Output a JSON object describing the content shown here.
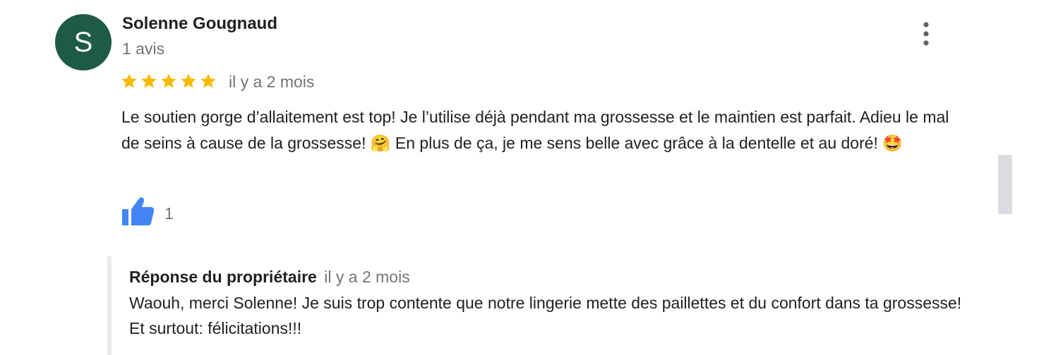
{
  "review": {
    "avatar_letter": "S",
    "avatar_color": "#1e5a47",
    "author_name": "Solenne Gougnaud",
    "author_review_count": "1 avis",
    "rating": 5,
    "rating_max": 5,
    "star_color": "#f6bb06",
    "date": "il y a 2 mois",
    "text": "Le soutien gorge d’allaitement est top! Je l’utilise déjà pendant ma grossesse et le maintien est parfait. Adieu le mal de seins à cause de la grossesse! 🤗 En plus de ça, je me sens belle avec grâce à la dentelle et au doré! 🤩",
    "like_count": "1",
    "like_icon": "thumbs-up-icon",
    "like_color": "#4285f4",
    "more_icon": "more-vertical-icon"
  },
  "owner_reply": {
    "title": "Réponse du propriétaire",
    "date": "il y a 2 mois",
    "text": "Waouh, merci Solenne! Je suis trop contente que notre lingerie mette des paillettes et du confort dans ta grossesse! Et surtout: félicitations!!!"
  }
}
